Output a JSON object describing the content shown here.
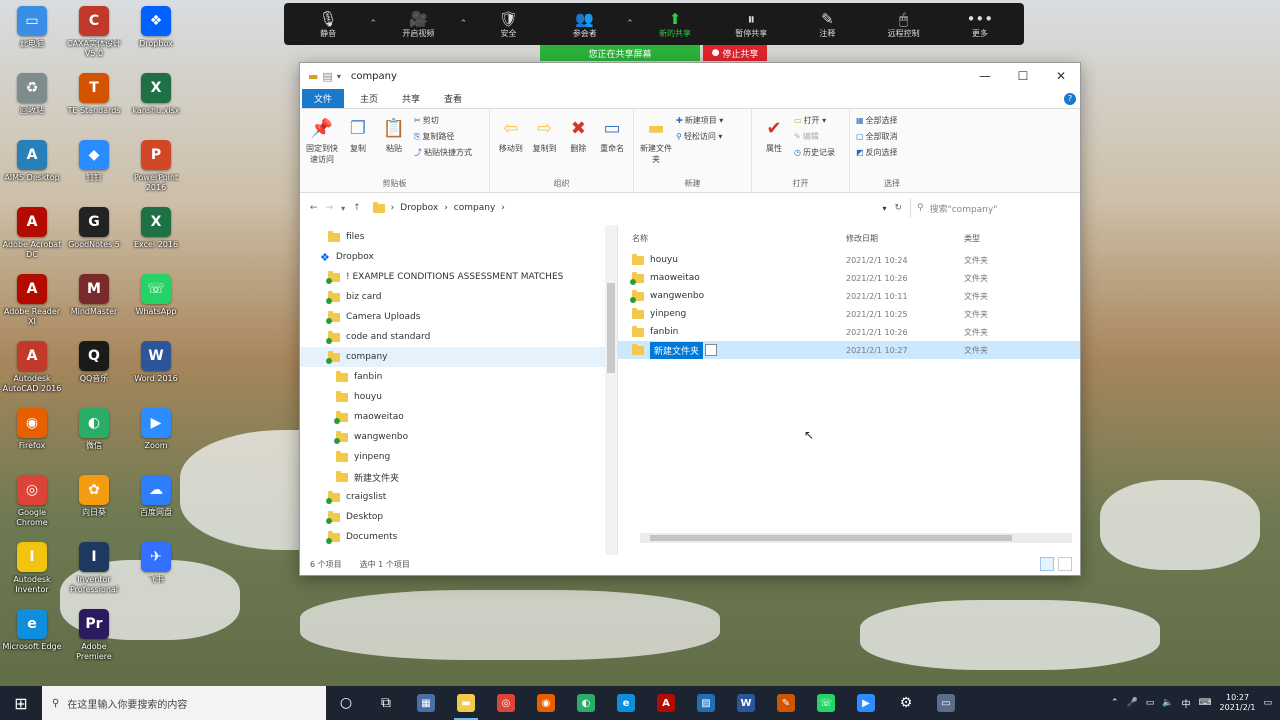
{
  "desktop_icons": [
    {
      "label": "此电脑",
      "color": "#3a8ee6",
      "glyph": "▭"
    },
    {
      "label": "CAXA实体设计 V5.0",
      "color": "#c0392b",
      "glyph": "C"
    },
    {
      "label": "Dropbox",
      "color": "#0061fe",
      "glyph": "❖"
    },
    {
      "label": "回收站",
      "color": "#7f8c8d",
      "glyph": "♻"
    },
    {
      "label": "TE Standards",
      "color": "#d35400",
      "glyph": "T"
    },
    {
      "label": "kanshu.xlsx",
      "color": "#1e7145",
      "glyph": "X"
    },
    {
      "label": "AIMS Desktop",
      "color": "#2980b9",
      "glyph": "A"
    },
    {
      "label": "钉钉",
      "color": "#2b8cff",
      "glyph": "◆"
    },
    {
      "label": "PowerPoint 2016",
      "color": "#d24726",
      "glyph": "P"
    },
    {
      "label": "Adobe Acrobat DC",
      "color": "#b30b00",
      "glyph": "A"
    },
    {
      "label": "GoodNotes 5",
      "color": "#222222",
      "glyph": "G"
    },
    {
      "label": "Excel 2016",
      "color": "#1e7145",
      "glyph": "X"
    },
    {
      "label": "Adobe Reader XI",
      "color": "#b30b00",
      "glyph": "A"
    },
    {
      "label": "MindMaster",
      "color": "#7a2a2a",
      "glyph": "M"
    },
    {
      "label": "WhatsApp",
      "color": "#25d366",
      "glyph": "☏"
    },
    {
      "label": "Autodesk AutoCAD 2016",
      "color": "#c0392b",
      "glyph": "A"
    },
    {
      "label": "QQ音乐",
      "color": "#1a1a1a",
      "glyph": "Q"
    },
    {
      "label": "Word 2016",
      "color": "#2b579a",
      "glyph": "W"
    },
    {
      "label": "Firefox",
      "color": "#e66000",
      "glyph": "◉"
    },
    {
      "label": "微信",
      "color": "#2aae67",
      "glyph": "◐"
    },
    {
      "label": "Zoom",
      "color": "#2d8cff",
      "glyph": "▶"
    },
    {
      "label": "Google Chrome",
      "color": "#db4437",
      "glyph": "◎"
    },
    {
      "label": "向日葵",
      "color": "#f39c12",
      "glyph": "✿"
    },
    {
      "label": "百度网盘",
      "color": "#2d7ff9",
      "glyph": "☁"
    },
    {
      "label": "Autodesk Inventor",
      "color": "#f1c40f",
      "glyph": "I"
    },
    {
      "label": "Inventor Professional",
      "color": "#1f3a60",
      "glyph": "I"
    },
    {
      "label": "飞书",
      "color": "#3370ff",
      "glyph": "✈"
    },
    {
      "label": "Microsoft Edge",
      "color": "#0f8fdb",
      "glyph": "e"
    },
    {
      "label": "Adobe Premiere",
      "color": "#2a1a5e",
      "glyph": "Pr"
    }
  ],
  "zoom": {
    "items": [
      {
        "icon": "🎙",
        "label": "静音"
      },
      {
        "icon": "🎥",
        "label": "开启视频"
      },
      {
        "icon": "🛡",
        "label": "安全"
      },
      {
        "icon": "👥",
        "label": "参会者"
      },
      {
        "icon": "⬆",
        "label": "新的共享"
      },
      {
        "icon": "⏸",
        "label": "暂停共享"
      },
      {
        "icon": "✎",
        "label": "注释"
      },
      {
        "icon": "🖱",
        "label": "远程控制"
      },
      {
        "icon": "•••",
        "label": "更多"
      }
    ],
    "banner": "您正在共享屏幕",
    "stop_label": "停止共享"
  },
  "explorer": {
    "title": "company",
    "tabs": [
      "文件",
      "主页",
      "共享",
      "查看"
    ],
    "ribbon": {
      "clipboard_group": "剪贴板",
      "pin_label": "固定到快速访问",
      "copy_label": "复制",
      "paste_label": "粘贴",
      "cut_label": "剪切",
      "copy_path_label": "复制路径",
      "paste_shortcut_label": "粘贴快捷方式",
      "organize_group": "组织",
      "move_to_label": "移动到",
      "copy_to_label": "复制到",
      "delete_label": "删除",
      "rename_label": "重命名",
      "new_group": "新建",
      "new_folder_label": "新建文件夹",
      "new_item_label": "新建项目",
      "easy_access_label": "轻松访问",
      "open_group": "打开",
      "properties_label": "属性",
      "open_label": "打开",
      "edit_label": "编辑",
      "history_label": "历史记录",
      "select_group": "选择",
      "select_all_label": "全部选择",
      "select_none_label": "全部取消",
      "invert_label": "反向选择"
    },
    "address": [
      "Dropbox",
      "company"
    ],
    "search_placeholder": "搜索\"company\"",
    "nav": [
      {
        "label": "files",
        "indent": 1,
        "sync": false
      },
      {
        "label": "Dropbox",
        "indent": 0,
        "sync": false,
        "dropbox": true
      },
      {
        "label": "! EXAMPLE CONDITIONS ASSESSMENT MATCHES",
        "indent": 1,
        "sync": true
      },
      {
        "label": "biz card",
        "indent": 1,
        "sync": true
      },
      {
        "label": "Camera Uploads",
        "indent": 1,
        "sync": true
      },
      {
        "label": "code and standard",
        "indent": 1,
        "sync": true
      },
      {
        "label": "company",
        "indent": 1,
        "sync": true,
        "selected": true
      },
      {
        "label": "fanbin",
        "indent": 2,
        "sync": false
      },
      {
        "label": "houyu",
        "indent": 2,
        "sync": false
      },
      {
        "label": "maoweitao",
        "indent": 2,
        "sync": true
      },
      {
        "label": "wangwenbo",
        "indent": 2,
        "sync": true
      },
      {
        "label": "yinpeng",
        "indent": 2,
        "sync": false
      },
      {
        "label": "新建文件夹",
        "indent": 2,
        "sync": false
      },
      {
        "label": "craigslist",
        "indent": 1,
        "sync": true
      },
      {
        "label": "Desktop",
        "indent": 1,
        "sync": true
      },
      {
        "label": "Documents",
        "indent": 1,
        "sync": true
      }
    ],
    "columns": {
      "name": "名称",
      "date": "修改日期",
      "type": "类型"
    },
    "files": [
      {
        "name": "houyu",
        "date": "2021/2/1 10:24",
        "type": "文件夹",
        "sync": false
      },
      {
        "name": "maoweitao",
        "date": "2021/2/1 10:26",
        "type": "文件夹",
        "sync": true
      },
      {
        "name": "wangwenbo",
        "date": "2021/2/1 10:11",
        "type": "文件夹",
        "sync": true
      },
      {
        "name": "yinpeng",
        "date": "2021/2/1 10:25",
        "type": "文件夹",
        "sync": false
      },
      {
        "name": "fanbin",
        "date": "2021/2/1 10:26",
        "type": "文件夹",
        "sync": false
      },
      {
        "name": "新建文件夹",
        "date": "2021/2/1 10:27",
        "type": "文件夹",
        "sync": false,
        "renaming": true
      }
    ],
    "status": {
      "count": "6 个项目",
      "selected": "选中 1 个项目"
    }
  },
  "taskbar": {
    "search_placeholder": "在这里输入你要搜索的内容",
    "apps": [
      {
        "name": "cortana-icon",
        "glyph": "○",
        "color": ""
      },
      {
        "name": "task-view-icon",
        "glyph": "⧉",
        "color": ""
      },
      {
        "name": "calculator-icon",
        "glyph": "▦",
        "color": "#4a6fa5"
      },
      {
        "name": "file-explorer-icon",
        "glyph": "▬",
        "color": "#f2c94c",
        "active": true
      },
      {
        "name": "chrome-icon",
        "glyph": "◎",
        "color": "#db4437"
      },
      {
        "name": "firefox-icon",
        "glyph": "◉",
        "color": "#e66000"
      },
      {
        "name": "wechat-icon",
        "glyph": "◐",
        "color": "#2aae67"
      },
      {
        "name": "edge-icon",
        "glyph": "e",
        "color": "#0f8fdb"
      },
      {
        "name": "acrobat-icon",
        "glyph": "A",
        "color": "#b30b00"
      },
      {
        "name": "photos-icon",
        "glyph": "▨",
        "color": "#1f6fb5"
      },
      {
        "name": "word-icon",
        "glyph": "W",
        "color": "#2b579a"
      },
      {
        "name": "paint-icon",
        "glyph": "✎",
        "color": "#d35400"
      },
      {
        "name": "whatsapp-icon",
        "glyph": "☏",
        "color": "#25d366"
      },
      {
        "name": "zoom-icon",
        "glyph": "▶",
        "color": "#2d8cff"
      },
      {
        "name": "settings-icon",
        "glyph": "⚙",
        "color": ""
      },
      {
        "name": "meeting-icon",
        "glyph": "▭",
        "color": "#5a6e8c"
      }
    ],
    "tray": {
      "ime": "中",
      "time": "10:27",
      "date": "2021/2/1"
    }
  }
}
